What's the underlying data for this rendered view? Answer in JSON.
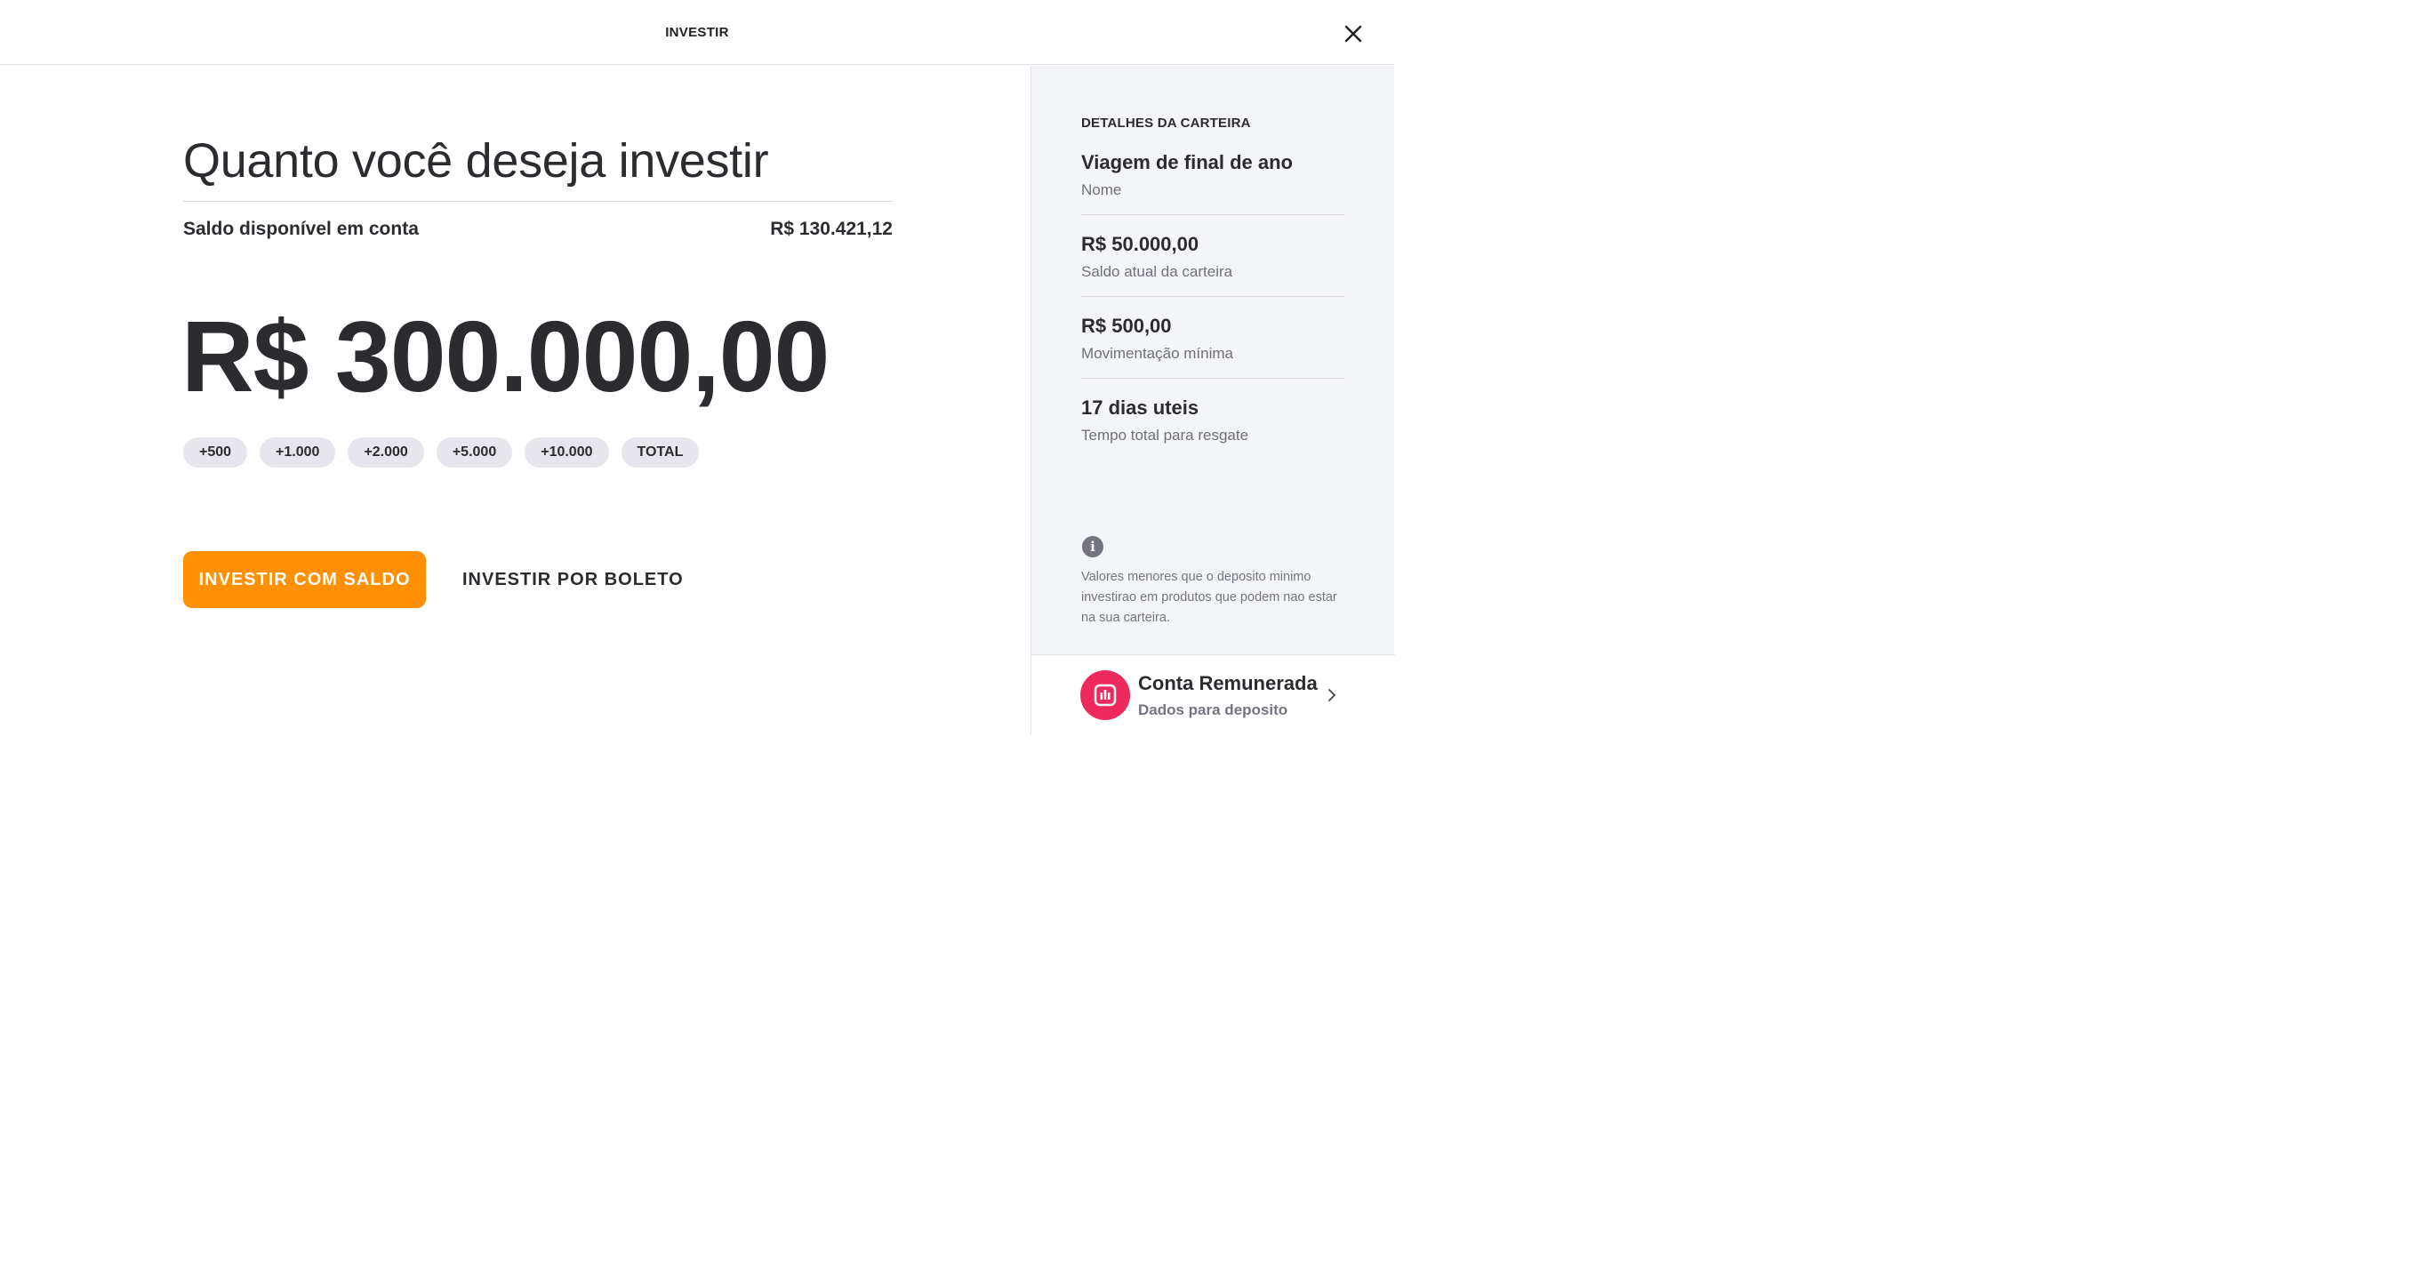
{
  "header": {
    "title": "INVESTIR",
    "close_icon": "close-icon"
  },
  "main": {
    "question": "Quanto você deseja investir",
    "balance_label": "Saldo disponível em conta",
    "balance_value": "R$ 130.421,12",
    "amount": "R$ 300.000,00",
    "chips": [
      "+500",
      "+1.000",
      "+2.000",
      "+5.000",
      "+10.000",
      "TOTAL"
    ],
    "primary_button": "INVESTIR COM SALDO",
    "secondary_button": "INVESTIR POR BOLETO"
  },
  "sidebar": {
    "heading": "DETALHES DA CARTEIRA",
    "details": [
      {
        "value": "Viagem de final de ano",
        "label": "Nome"
      },
      {
        "value": "R$ 50.000,00",
        "label": "Saldo atual da carteira"
      },
      {
        "value": "R$ 500,00",
        "label": "Movimentação mínima"
      },
      {
        "value": "17 dias uteis",
        "label": "Tempo total para resgate"
      }
    ],
    "info_icon": "info-icon",
    "info_text": "Valores menores que o deposito minimo investirao em produtos que podem nao estar na sua carteira.",
    "account_card": {
      "title": "Conta Remunerada",
      "subtitle": "Dados para deposito",
      "logo_icon": "bar-chart-icon",
      "chevron_icon": "chevron-right-icon"
    }
  },
  "colors": {
    "accent": "#ff9004",
    "account_logo": "#ee2a5d",
    "sidebar_bg": "#f4f5f8",
    "chip_bg": "#e6e6ec"
  }
}
